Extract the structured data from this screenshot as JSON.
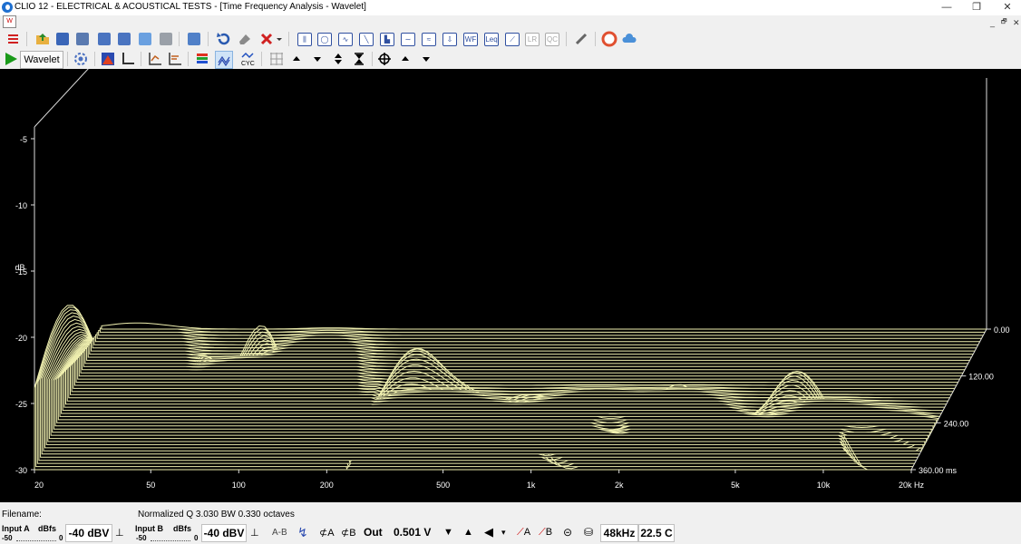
{
  "window": {
    "title": "CLIO 12 - ELECTRICAL & ACOUSTICAL TESTS - [Time Frequency Analysis - Wavelet]",
    "controls": [
      "—",
      "❐",
      "✕"
    ],
    "mdi_controls": [
      "_",
      "🗗",
      "✕"
    ]
  },
  "toolbar2": {
    "wavelet_label": "Wavelet"
  },
  "chart_data": {
    "type": "waterfall",
    "y_axis": {
      "unit_label": "dB",
      "ticks": [
        "-5",
        "-10",
        "-15",
        "-20",
        "-25",
        "-30"
      ],
      "range": [
        -30,
        0
      ]
    },
    "x_axis": {
      "scale": "log",
      "ticks": [
        "20",
        "50",
        "100",
        "200",
        "500",
        "1k",
        "2k",
        "5k",
        "10k",
        "20k Hz"
      ],
      "range_hz": [
        20,
        20000
      ]
    },
    "time_axis": {
      "ticks": [
        "0.00",
        "120.00",
        "240.00",
        "360.00 ms"
      ],
      "range_ms": [
        0,
        360
      ]
    },
    "slice_count": 46,
    "line_color": "#f0f0b0",
    "background": "#000000"
  },
  "status": {
    "filename_label": "Filename:",
    "normalized_text": "Normalized  Q 3.030  BW 0.330 octaves",
    "input_a_label": "Input A",
    "input_b_label": "Input B",
    "dbfs_label": "dBfs",
    "scale_min": "-50",
    "scale_max": "0",
    "input_a_value": "-40 dBV",
    "input_b_value": "-40 dBV",
    "ab_label": "A-B",
    "ca_label": "A",
    "cb_label": "B",
    "out_label": "Out",
    "out_value": "0.501 V",
    "fa_label": "A",
    "fb_label": "B",
    "sample_rate": "48kHz",
    "temperature": "22.5 C"
  }
}
